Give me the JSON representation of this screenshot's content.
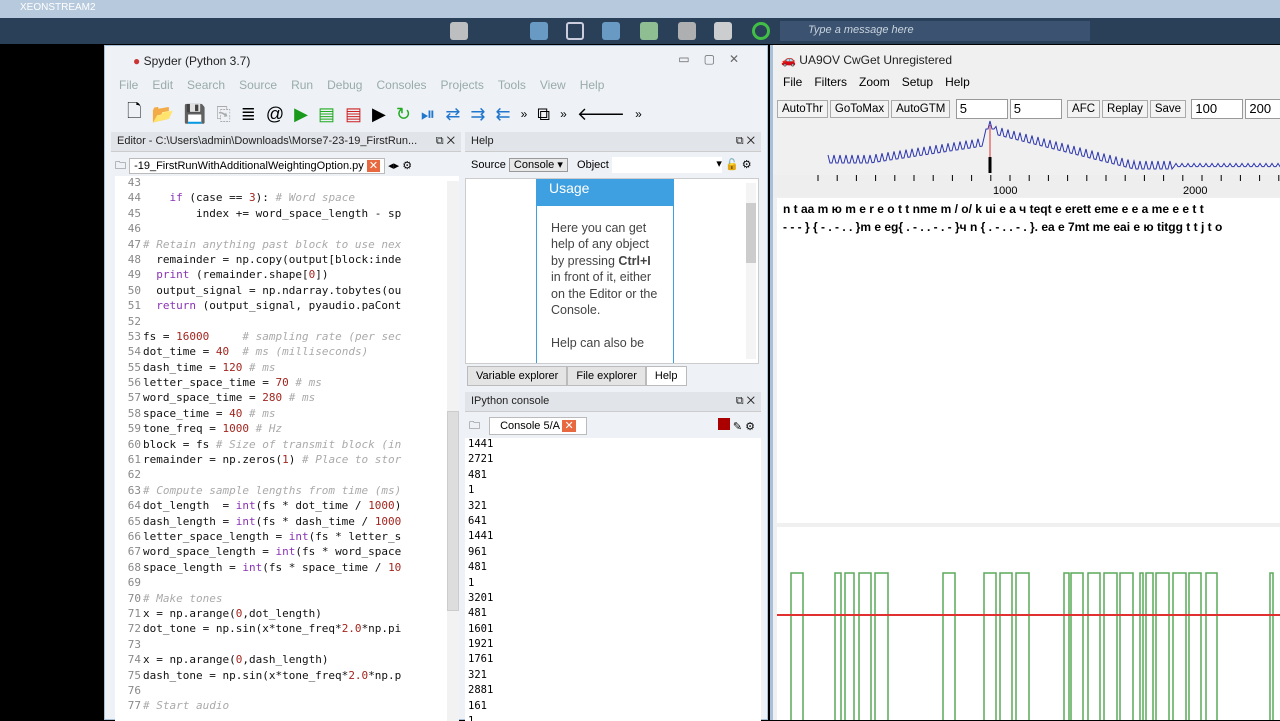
{
  "taskbar": {
    "title": "XEONSTREAM2",
    "message_placeholder": "Type a message here"
  },
  "spyder": {
    "title": "Spyder (Python 3.7)",
    "menu": [
      "File",
      "Edit",
      "Search",
      "Source",
      "Run",
      "Debug",
      "Consoles",
      "Projects",
      "Tools",
      "View",
      "Help"
    ],
    "editor_title": "Editor - C:\\Users\\admin\\Downloads\\Morse7-23-19_FirstRun...",
    "file_tab": "-19_FirstRunWithAdditionalWeightingOption.py",
    "code": [
      {
        "n": "43",
        "s": []
      },
      {
        "n": "44",
        "s": [
          [
            "",
            "    "
          ],
          [
            "kw",
            "if"
          ],
          [
            "",
            " (case == "
          ],
          [
            "num",
            "3"
          ],
          [
            "",
            "): "
          ],
          [
            "cm",
            "# Word space"
          ]
        ]
      },
      {
        "n": "45",
        "s": [
          [
            "",
            "        index += word_space_length - sp"
          ]
        ]
      },
      {
        "n": "46",
        "s": []
      },
      {
        "n": "47",
        "s": [
          [
            "cm",
            "# Retain anything past block to use nex"
          ]
        ]
      },
      {
        "n": "48",
        "s": [
          [
            "",
            "  remainder = np.copy(output[block:inde"
          ]
        ]
      },
      {
        "n": "49",
        "s": [
          [
            "",
            "  "
          ],
          [
            "kw",
            "print"
          ],
          [
            "",
            " (remainder.shape["
          ],
          [
            "num",
            "0"
          ],
          [
            "",
            "])"
          ]
        ]
      },
      {
        "n": "50",
        "s": [
          [
            "",
            "  output_signal = np.ndarray.tobytes(ou"
          ]
        ]
      },
      {
        "n": "51",
        "s": [
          [
            "",
            "  "
          ],
          [
            "kw",
            "return"
          ],
          [
            "",
            " (output_signal, pyaudio.paCont"
          ]
        ]
      },
      {
        "n": "52",
        "s": []
      },
      {
        "n": "53",
        "s": [
          [
            "",
            "fs = "
          ],
          [
            "num",
            "16000"
          ],
          [
            "",
            "     "
          ],
          [
            "cm",
            "# sampling rate (per sec"
          ]
        ]
      },
      {
        "n": "54",
        "s": [
          [
            "",
            "dot_time = "
          ],
          [
            "num",
            "40"
          ],
          [
            "",
            "  "
          ],
          [
            "cm",
            "# ms (milliseconds)"
          ]
        ]
      },
      {
        "n": "55",
        "s": [
          [
            "",
            "dash_time = "
          ],
          [
            "num",
            "120"
          ],
          [
            "",
            " "
          ],
          [
            "cm",
            "# ms"
          ]
        ]
      },
      {
        "n": "56",
        "s": [
          [
            "",
            "letter_space_time = "
          ],
          [
            "num",
            "70"
          ],
          [
            "",
            " "
          ],
          [
            "cm",
            "# ms"
          ]
        ]
      },
      {
        "n": "57",
        "s": [
          [
            "",
            "word_space_time = "
          ],
          [
            "num",
            "280"
          ],
          [
            "",
            " "
          ],
          [
            "cm",
            "# ms"
          ]
        ]
      },
      {
        "n": "58",
        "s": [
          [
            "",
            "space_time = "
          ],
          [
            "num",
            "40"
          ],
          [
            "",
            " "
          ],
          [
            "cm",
            "# ms"
          ]
        ]
      },
      {
        "n": "59",
        "s": [
          [
            "",
            "tone_freq = "
          ],
          [
            "num",
            "1000"
          ],
          [
            "",
            " "
          ],
          [
            "cm",
            "# Hz"
          ]
        ]
      },
      {
        "n": "60",
        "s": [
          [
            "",
            "block = fs "
          ],
          [
            "cm",
            "# Size of transmit block (in"
          ]
        ]
      },
      {
        "n": "61",
        "s": [
          [
            "",
            "remainder = np.zeros("
          ],
          [
            "num",
            "1"
          ],
          [
            "",
            ") "
          ],
          [
            "cm",
            "# Place to stor"
          ]
        ]
      },
      {
        "n": "62",
        "s": []
      },
      {
        "n": "63",
        "s": [
          [
            "cm",
            "# Compute sample lengths from time (ms)"
          ]
        ]
      },
      {
        "n": "64",
        "s": [
          [
            "",
            "dot_length  = "
          ],
          [
            "kw",
            "int"
          ],
          [
            "",
            "(fs * dot_time / "
          ],
          [
            "num",
            "1000"
          ],
          [
            "",
            ")"
          ]
        ]
      },
      {
        "n": "65",
        "s": [
          [
            "",
            "dash_length = "
          ],
          [
            "kw",
            "int"
          ],
          [
            "",
            "(fs * dash_time / "
          ],
          [
            "num",
            "1000"
          ]
        ]
      },
      {
        "n": "66",
        "s": [
          [
            "",
            "letter_space_length = "
          ],
          [
            "kw",
            "int"
          ],
          [
            "",
            "(fs * letter_s"
          ]
        ]
      },
      {
        "n": "67",
        "s": [
          [
            "",
            "word_space_length = "
          ],
          [
            "kw",
            "int"
          ],
          [
            "",
            "(fs * word_space"
          ]
        ]
      },
      {
        "n": "68",
        "s": [
          [
            "",
            "space_length = "
          ],
          [
            "kw",
            "int"
          ],
          [
            "",
            "(fs * space_time / "
          ],
          [
            "num",
            "10"
          ]
        ]
      },
      {
        "n": "69",
        "s": []
      },
      {
        "n": "70",
        "s": [
          [
            "cm",
            "# Make tones"
          ]
        ]
      },
      {
        "n": "71",
        "s": [
          [
            "",
            "x = np.arange("
          ],
          [
            "num",
            "0"
          ],
          [
            "",
            ",dot_length)"
          ]
        ]
      },
      {
        "n": "72",
        "s": [
          [
            "",
            "dot_tone = np.sin(x*tone_freq*"
          ],
          [
            "num",
            "2.0"
          ],
          [
            "",
            "*np.pi"
          ]
        ]
      },
      {
        "n": "73",
        "s": []
      },
      {
        "n": "74",
        "s": [
          [
            "",
            "x = np.arange("
          ],
          [
            "num",
            "0"
          ],
          [
            "",
            ",dash_length)"
          ]
        ]
      },
      {
        "n": "75",
        "s": [
          [
            "",
            "dash_tone = np.sin(x*tone_freq*"
          ],
          [
            "num",
            "2.0"
          ],
          [
            "",
            "*np.p"
          ]
        ]
      },
      {
        "n": "76",
        "s": []
      },
      {
        "n": "77",
        "s": [
          [
            "cm",
            "# Start audio"
          ]
        ]
      }
    ],
    "help": {
      "title": "Help",
      "source_label": "Source",
      "source_value": "Console",
      "object_label": "Object",
      "usage_heading": "Usage",
      "text1": "Here you can get help of any object by pressing",
      "ctrl": "Ctrl+I",
      "text2": "in front of it, either on the Editor or the Console.",
      "text3": "Help can also be",
      "tabs": [
        "Variable explorer",
        "File explorer",
        "Help"
      ]
    },
    "console": {
      "title": "IPython console",
      "tab": "Console 5/A",
      "output": [
        "1441",
        "2721",
        "481",
        "1",
        "321",
        "641",
        "1441",
        "961",
        "481",
        "1",
        "3201",
        "481",
        "1601",
        "1921",
        "1761",
        "321",
        "2881",
        "161",
        "1"
      ]
    }
  },
  "cwget": {
    "title": "UA9OV CwGet   Unregistered",
    "menu": [
      "File",
      "Filters",
      "Zoom",
      "Setup",
      "Help"
    ],
    "buttons": [
      "AutoThr",
      "GoToMax",
      "AutoGTM"
    ],
    "spin1": "5",
    "spin2": "5",
    "afc": "AFC",
    "replay": "Replay",
    "save": "Save",
    "spin3": "100",
    "spin4": "200",
    "axis": [
      "1000",
      "2000"
    ],
    "decoded": [
      "n t aa m ю m e r e o t t nme m / o/ k ui e a ч teqt e erett eme e e a me e e t t",
      "- - - } { - . - . . }m e eg{ . - . . - . - }ч n { . - . . - . }. ea e 7mt me eai e ю titgg t t j t o"
    ],
    "colors": {
      "spectrum": "#2b35b0",
      "threshold": "#e03030",
      "signal": "#5aa85a"
    }
  }
}
